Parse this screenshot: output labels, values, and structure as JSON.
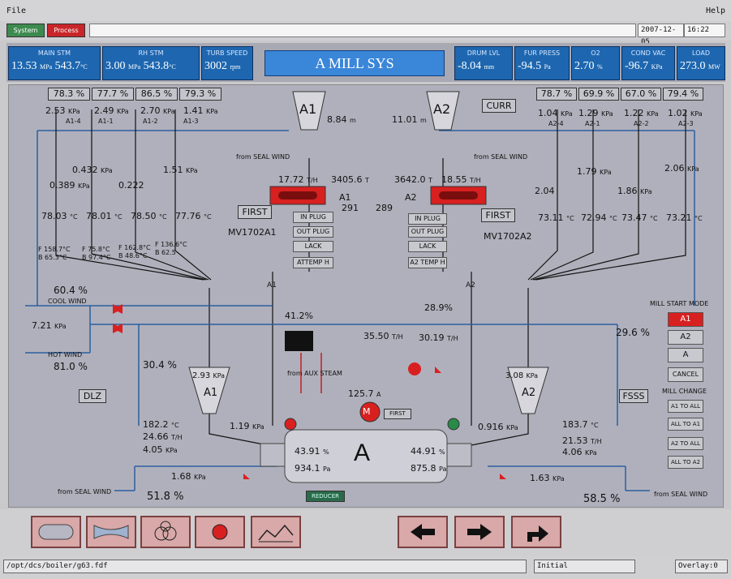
{
  "menu": {
    "file": "File",
    "help": "Help"
  },
  "toolbar": {
    "system": "System",
    "process": "Process",
    "date": "2007-12-05",
    "time": "16:22"
  },
  "header": {
    "main_stm": {
      "label": "MAIN STM",
      "v1": "13.53",
      "u1": "MPa",
      "v2": "543.7",
      "u2": "°C"
    },
    "rh_stm": {
      "label": "RH STM",
      "v1": "3.00",
      "u1": "MPa",
      "v2": "543.8",
      "u2": "°C"
    },
    "turb": {
      "label": "TURB SPEED",
      "v": "3002",
      "u": "rpm"
    },
    "title": "A MILL SYS",
    "drum": {
      "label": "DRUM LVL",
      "v": "-8.04",
      "u": "mm"
    },
    "fur": {
      "label": "FUR PRESS",
      "v": "-94.5",
      "u": "Pa"
    },
    "o2": {
      "label": "O2",
      "v": "2.70",
      "u": "%"
    },
    "cond": {
      "label": "COND VAC",
      "v": "-96.7",
      "u": "KPa"
    },
    "load": {
      "label": "LOAD",
      "v": "273.0",
      "u": "MW"
    }
  },
  "panel": {
    "left_pct": [
      "78.3",
      "77.7",
      "86.5",
      "79.3"
    ],
    "right_pct": [
      "78.7",
      "69.9",
      "67.0",
      "79.4"
    ],
    "pct_sign": "%",
    "left_kpa": [
      "2.53",
      "2.49",
      "2.70",
      "1.41"
    ],
    "right_kpa": [
      "1.04",
      "1.29",
      "1.22",
      "1.02"
    ],
    "kpa": "KPa",
    "left_tags": [
      "A1-4",
      "A1-1",
      "A1-2",
      "A1-3"
    ],
    "right_tags": [
      "A2-4",
      "A2-1",
      "A2-2",
      "A2-3"
    ],
    "bunker_a1": "A1",
    "bunker_a2": "A2",
    "lvl_a1": "8.84",
    "lvl_a2": "11.01",
    "m": "m",
    "curr": "CURR",
    "mid_left_kpa": [
      "0.432",
      "1.51"
    ],
    "low_left_kpa": [
      "0.389",
      "0.222"
    ],
    "mid_right_kpa": [
      "1.79",
      "2.06"
    ],
    "low_right_kpa": [
      "2.04",
      "1.86"
    ],
    "left_temps": [
      "78.03",
      "78.01",
      "78.50",
      "77.76"
    ],
    "right_temps": [
      "73.11",
      "72.94",
      "73.47",
      "73.21"
    ],
    "degc": "°C",
    "left_f1": "F 158.7°C",
    "left_b1": "B 65.3°C",
    "left_f2": "F 75.8°C",
    "left_b2": "B 97.4°C",
    "left_f3": "F 162.8°C",
    "left_b3": "B 48.6°C",
    "left_f4": "F 136.6°C",
    "left_b4": "B 62.5",
    "seal_wind": "from SEAL WIND",
    "feeder_a1_flow": "17.72",
    "feeder_a2_flow": "18.55",
    "th": "T/H",
    "feeder_a1_total": "3405.6",
    "feeder_a2_total": "3642.0",
    "tt": "T",
    "feeder_a1_tag": "A1",
    "feeder_a2_tag": "A2",
    "num_291": "291",
    "num_289": "289",
    "first": "FIRST",
    "in_plug": "IN PLUG",
    "out_plug": "OUT PLUG",
    "lack": "LACK",
    "attemp": "ATTEMP H",
    "a2temp": "A2 TEMP H",
    "mv_a1": "MV1702A1",
    "mv_a2": "MV1702A2",
    "cool_wind": "COOL WIND",
    "hot_wind": "HOT WIND",
    "cool_pct": "60.4",
    "hot_pct": "81.0",
    "air_kpa": "7.21",
    "damper_a1": "30.4",
    "damper_mid": "41.2",
    "damper_mid2": "28.9",
    "damper_right": "29.6",
    "flow_a1": "35.50",
    "flow_a2": "30.19",
    "aux_steam": "from AUX STEAM",
    "current": "125.7",
    "amp": "A",
    "sep_a1": "2.93",
    "sep_a2": "3.08",
    "dlz": "DLZ",
    "fsss": "FSSS",
    "a1_temp": "182.2",
    "a1_flow": "24.66",
    "a1_kpa": "4.05",
    "a1_dp": "1.19",
    "a2_temp": "183.7",
    "a2_flow": "21.53",
    "a2_kpa": "4.06",
    "a2_dp": "0.916",
    "mill_label": "A",
    "mill_l_pct": "43.91",
    "mill_r_pct": "44.91",
    "mill_l_pa": "934.1",
    "mill_r_pa": "875.8",
    "pa": "Pa",
    "seal_l_kpa": "1.68",
    "seal_r_kpa": "1.63",
    "seal_l_pct": "51.8",
    "seal_r_pct": "58.5",
    "motor_m": "M",
    "reducer": "REDUCER"
  },
  "mill_start": {
    "title": "MILL START MODE",
    "a1": "A1",
    "a2": "A2",
    "a": "A",
    "cancel": "CANCEL",
    "change": "MILL CHANGE",
    "ch": [
      "A1 TO ALL",
      "ALL TO A1",
      "A2 TO ALL",
      "ALL TO A2"
    ]
  },
  "status": {
    "path": "/opt/dcs/boiler/g63.fdf",
    "mode": "Initial",
    "overlay": "Overlay:0"
  }
}
